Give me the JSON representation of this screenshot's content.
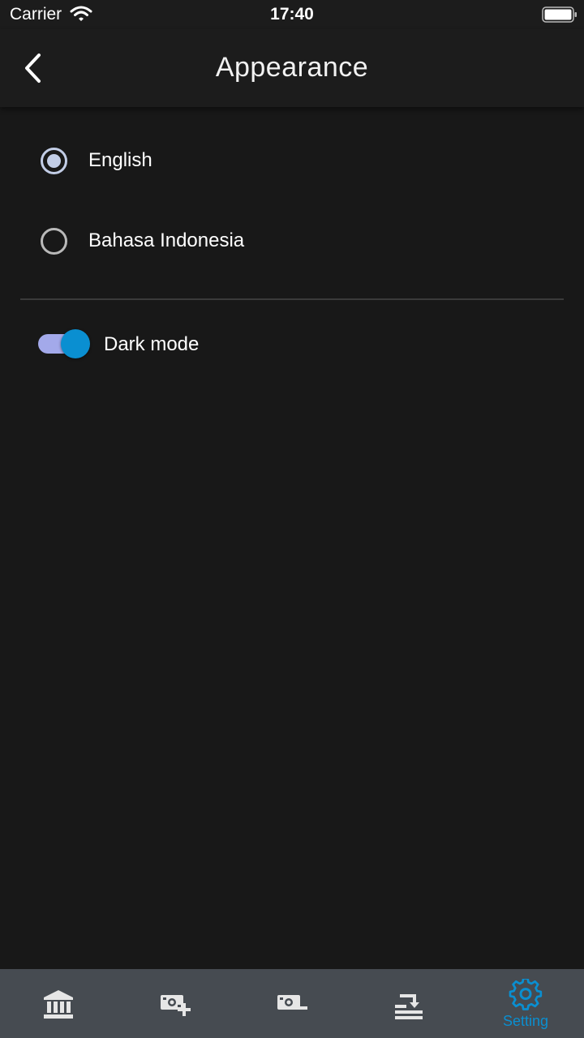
{
  "status_bar": {
    "carrier": "Carrier",
    "time": "17:40"
  },
  "app_bar": {
    "title": "Appearance",
    "back_icon": "chevron-left-icon"
  },
  "language": {
    "options": [
      {
        "label": "English",
        "selected": true
      },
      {
        "label": "Bahasa Indonesia",
        "selected": false
      }
    ]
  },
  "dark_mode": {
    "label": "Dark mode",
    "enabled": true
  },
  "bottom_nav": {
    "items": [
      {
        "icon": "bank-icon",
        "label": "",
        "active": false
      },
      {
        "icon": "add-money-icon",
        "label": "",
        "active": false
      },
      {
        "icon": "remove-money-icon",
        "label": "",
        "active": false
      },
      {
        "icon": "transfer-list-icon",
        "label": "",
        "active": false
      },
      {
        "icon": "gear-icon",
        "label": "Setting",
        "active": true
      }
    ]
  },
  "colors": {
    "background": "#181818",
    "bar": "#1c1c1c",
    "nav": "#464b51",
    "accent": "#0a8fd1",
    "toggle_track": "#a3a9ea",
    "nav_icon": "#e6e6e6"
  }
}
